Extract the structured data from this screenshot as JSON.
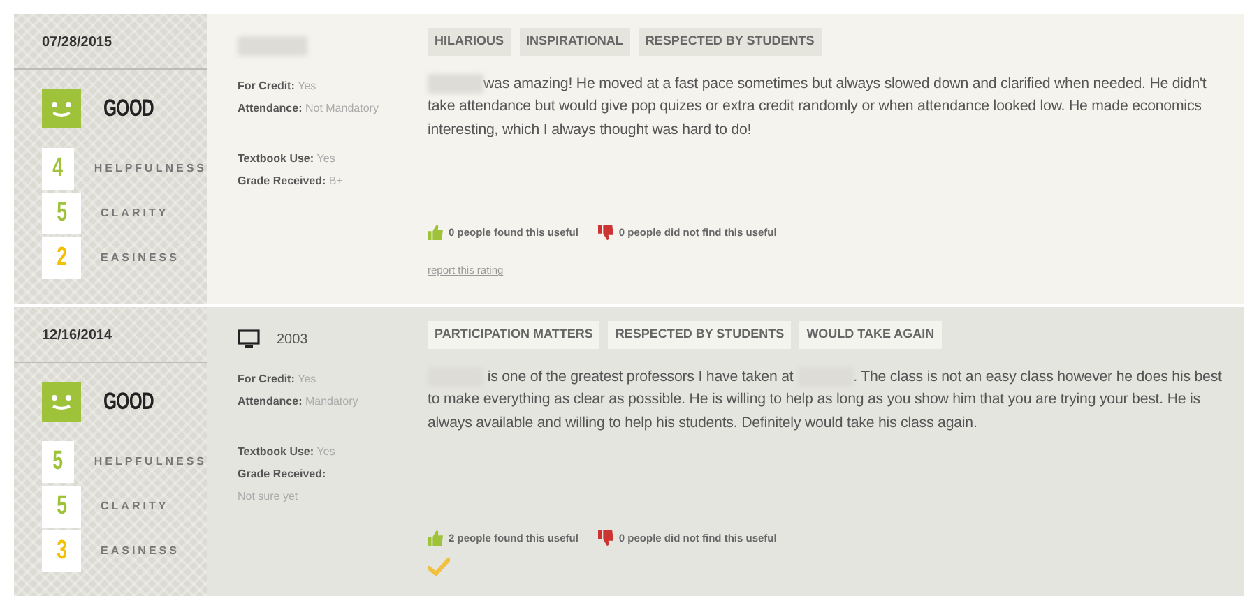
{
  "ratings": [
    {
      "date": "07/28/2015",
      "quality": {
        "kind": "good",
        "label": "GOOD"
      },
      "scores": [
        {
          "value": "4",
          "label": "HELPFULNESS",
          "color": "#9ec33a"
        },
        {
          "value": "5",
          "label": "CLARITY",
          "color": "#9ec33a"
        },
        {
          "value": "2",
          "label": "EASINESS",
          "color": "#f2c200"
        }
      ],
      "class": {
        "kind": "redacted"
      },
      "details": [
        [
          {
            "kind": "inline",
            "label": "For Credit:",
            "value": "Yes"
          },
          {
            "kind": "inline",
            "label": "Attendance:",
            "value": "Not Mandatory"
          }
        ],
        [
          {
            "kind": "inline",
            "label": "Textbook Use:",
            "value": "Yes"
          },
          {
            "kind": "inline",
            "label": "Grade Received:",
            "value": "B+"
          }
        ]
      ],
      "tags": [
        "HILARIOUS",
        "INSPIRATIONAL",
        "RESPECTED BY STUDENTS"
      ],
      "comment": [
        {
          "kind": "redacted"
        },
        {
          "kind": "text",
          "text": "was amazing! He moved at a fast pace sometimes but always slowed down and clarified when needed. He didn't take attendance but would give pop quizes or extra credit randomly or when attendance looked low. He made economics interesting, which I always thought was hard to do!"
        }
      ],
      "useful": "0 people found this useful",
      "not_useful": "0 people did not find this useful",
      "report": "report this rating",
      "verified": false
    },
    {
      "date": "12/16/2014",
      "quality": {
        "kind": "good",
        "label": "GOOD"
      },
      "scores": [
        {
          "value": "5",
          "label": "HELPFULNESS",
          "color": "#9ec33a"
        },
        {
          "value": "5",
          "label": "CLARITY",
          "color": "#9ec33a"
        },
        {
          "value": "3",
          "label": "EASINESS",
          "color": "#f2c200"
        }
      ],
      "class": {
        "kind": "online",
        "text": "2003"
      },
      "details": [
        [
          {
            "kind": "inline",
            "label": "For Credit:",
            "value": "Yes"
          },
          {
            "kind": "inline",
            "label": "Attendance:",
            "value": "Mandatory"
          }
        ],
        [
          {
            "kind": "inline",
            "label": "Textbook Use:",
            "value": "Yes"
          },
          {
            "kind": "stacked",
            "label": "Grade Received:",
            "value": "Not sure yet"
          }
        ]
      ],
      "tags": [
        "PARTICIPATION MATTERS",
        "RESPECTED BY STUDENTS",
        "WOULD TAKE AGAIN"
      ],
      "comment": [
        {
          "kind": "redacted"
        },
        {
          "kind": "text",
          "text": " is one of the greatest professors I have taken at "
        },
        {
          "kind": "redacted"
        },
        {
          "kind": "text",
          "text": ". The class is not an easy class however he does his best to make everything as clear as possible. He is willing to help as long as you show him that you are trying your best. He is always available and willing to help his students. Definitely would take his class again."
        }
      ],
      "useful": "2 people found this useful",
      "not_useful": "0 people did not find this useful",
      "verified": true
    }
  ]
}
